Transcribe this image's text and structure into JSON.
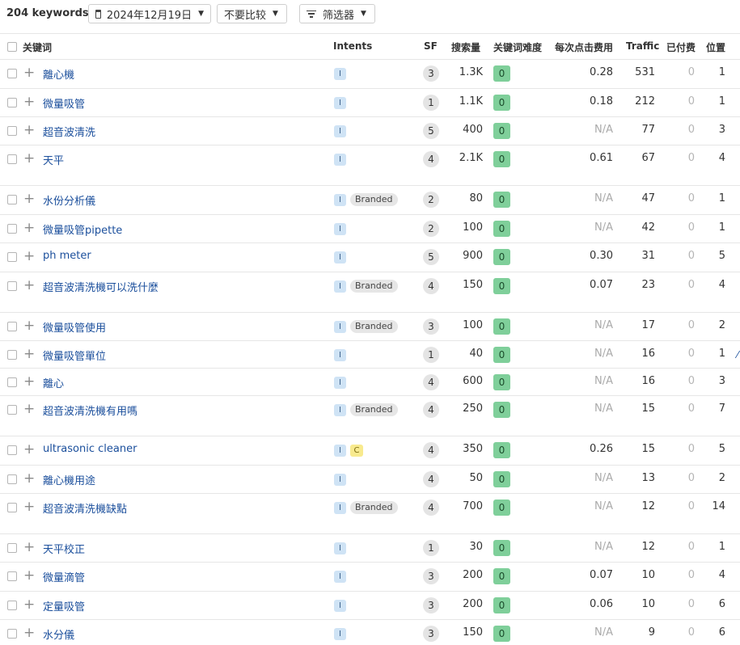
{
  "toolbar": {
    "keyword_count": "204 keywords",
    "date": "2024年12月19日",
    "compare": "不要比较",
    "filter": "筛选器"
  },
  "columns": {
    "keyword": "关键词",
    "intents": "Intents",
    "sf": "SF",
    "volume": "搜索量",
    "kd": "关键词难度",
    "cpc": "每次点击费用",
    "traffic": "Traffic",
    "paid": "已付费",
    "position": "位置"
  },
  "rows": [
    {
      "keyword": "離心機",
      "intents": [
        "I"
      ],
      "branded": "",
      "sf": "3",
      "volume": "1.3K",
      "kd": "0",
      "cpc": "0.28",
      "traffic": "531",
      "paid": "0",
      "position": "1"
    },
    {
      "keyword": "微量吸管",
      "intents": [
        "I"
      ],
      "branded": "",
      "sf": "1",
      "volume": "1.1K",
      "kd": "0",
      "cpc": "0.18",
      "traffic": "212",
      "paid": "0",
      "position": "1"
    },
    {
      "keyword": "超音波清洗",
      "intents": [
        "I"
      ],
      "branded": "",
      "sf": "5",
      "volume": "400",
      "kd": "0",
      "cpc": "N/A",
      "traffic": "77",
      "paid": "0",
      "position": "3"
    },
    {
      "keyword": "天平",
      "intents": [
        "I"
      ],
      "branded": "",
      "sf": "4",
      "volume": "2.1K",
      "kd": "0",
      "cpc": "0.61",
      "traffic": "67",
      "paid": "0",
      "position": "4"
    },
    {
      "keyword": "水份分析儀",
      "intents": [
        "I"
      ],
      "branded": "Branded",
      "sf": "2",
      "volume": "80",
      "kd": "0",
      "cpc": "N/A",
      "traffic": "47",
      "paid": "0",
      "position": "1"
    },
    {
      "keyword": "微量吸管pipette",
      "intents": [
        "I"
      ],
      "branded": "",
      "sf": "2",
      "volume": "100",
      "kd": "0",
      "cpc": "N/A",
      "traffic": "42",
      "paid": "0",
      "position": "1"
    },
    {
      "keyword": "ph meter",
      "intents": [
        "I"
      ],
      "branded": "",
      "sf": "5",
      "volume": "900",
      "kd": "0",
      "cpc": "0.30",
      "traffic": "31",
      "paid": "0",
      "position": "5"
    },
    {
      "keyword": "超音波清洗機可以洗什麼",
      "intents": [
        "I"
      ],
      "branded": "Branded",
      "sf": "4",
      "volume": "150",
      "kd": "0",
      "cpc": "0.07",
      "traffic": "23",
      "paid": "0",
      "position": "4"
    },
    {
      "keyword": "微量吸管使用",
      "intents": [
        "I"
      ],
      "branded": "Branded",
      "sf": "3",
      "volume": "100",
      "kd": "0",
      "cpc": "N/A",
      "traffic": "17",
      "paid": "0",
      "position": "2"
    },
    {
      "keyword": "微量吸管單位",
      "intents": [
        "I"
      ],
      "branded": "",
      "sf": "1",
      "volume": "40",
      "kd": "0",
      "cpc": "N/A",
      "traffic": "16",
      "paid": "0",
      "position": "1"
    },
    {
      "keyword": "離心",
      "intents": [
        "I"
      ],
      "branded": "",
      "sf": "4",
      "volume": "600",
      "kd": "0",
      "cpc": "N/A",
      "traffic": "16",
      "paid": "0",
      "position": "3"
    },
    {
      "keyword": "超音波清洗機有用嗎",
      "intents": [
        "I"
      ],
      "branded": "Branded",
      "sf": "4",
      "volume": "250",
      "kd": "0",
      "cpc": "N/A",
      "traffic": "15",
      "paid": "0",
      "position": "7"
    },
    {
      "keyword": "ultrasonic cleaner",
      "intents": [
        "I",
        "C"
      ],
      "branded": "",
      "sf": "4",
      "volume": "350",
      "kd": "0",
      "cpc": "0.26",
      "traffic": "15",
      "paid": "0",
      "position": "5"
    },
    {
      "keyword": "離心機用途",
      "intents": [
        "I"
      ],
      "branded": "",
      "sf": "4",
      "volume": "50",
      "kd": "0",
      "cpc": "N/A",
      "traffic": "13",
      "paid": "0",
      "position": "2"
    },
    {
      "keyword": "超音波清洗機缺點",
      "intents": [
        "I"
      ],
      "branded": "Branded",
      "sf": "4",
      "volume": "700",
      "kd": "0",
      "cpc": "N/A",
      "traffic": "12",
      "paid": "0",
      "position": "14"
    },
    {
      "keyword": "天平校正",
      "intents": [
        "I"
      ],
      "branded": "",
      "sf": "1",
      "volume": "30",
      "kd": "0",
      "cpc": "N/A",
      "traffic": "12",
      "paid": "0",
      "position": "1"
    },
    {
      "keyword": "微量滴管",
      "intents": [
        "I"
      ],
      "branded": "",
      "sf": "3",
      "volume": "200",
      "kd": "0",
      "cpc": "0.07",
      "traffic": "10",
      "paid": "0",
      "position": "4"
    },
    {
      "keyword": "定量吸管",
      "intents": [
        "I"
      ],
      "branded": "",
      "sf": "3",
      "volume": "200",
      "kd": "0",
      "cpc": "0.06",
      "traffic": "10",
      "paid": "0",
      "position": "6"
    },
    {
      "keyword": "水分儀",
      "intents": [
        "I"
      ],
      "branded": "",
      "sf": "3",
      "volume": "150",
      "kd": "0",
      "cpc": "N/A",
      "traffic": "9",
      "paid": "0",
      "position": "6"
    }
  ]
}
